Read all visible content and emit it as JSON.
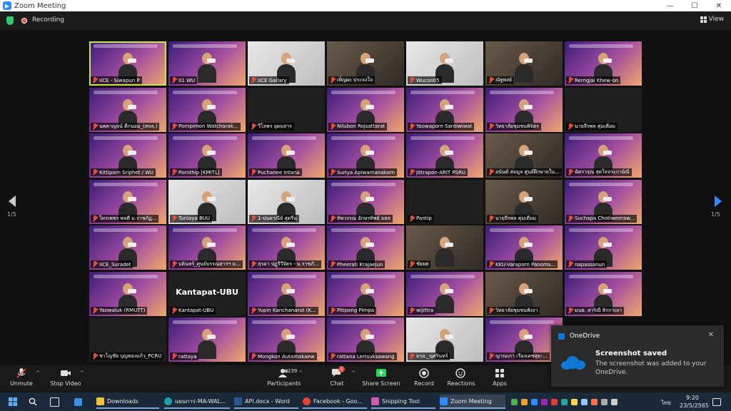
{
  "window": {
    "title": "Zoom Meeting",
    "min": "—",
    "max": "☐",
    "close": "✕"
  },
  "meeting": {
    "recording_label": "Recording",
    "view_label": "View"
  },
  "pager": {
    "page": "1/5"
  },
  "participants": [
    {
      "name": "IICE - Siwapun P",
      "style": "active"
    },
    {
      "name": "01 WU",
      "style": "slide"
    },
    {
      "name": "IICE Gallary",
      "style": "light"
    },
    {
      "name": "เพ็ญผะ ประจงใจ",
      "style": "photo"
    },
    {
      "name": "Wucon05",
      "style": "light"
    },
    {
      "name": "ณัฐพงษ์",
      "style": "photo"
    },
    {
      "name": "Rerngjai Khew-on",
      "style": "slide"
    },
    {
      "name": "นพคาญจน์ ดีกนอม_(สจล.)",
      "style": "slide"
    },
    {
      "name": "Pornpimon Watcharak...",
      "style": "slide"
    },
    {
      "name": "วีโลพร อุดมสาร",
      "style": "dark"
    },
    {
      "name": "Nilubon Rojsattarat",
      "style": "slide"
    },
    {
      "name": "Yaowaporn Santiwiwat",
      "style": "slide"
    },
    {
      "name": "วิทยาลัยชุมชนพิจิตร",
      "style": "slide"
    },
    {
      "name": "นายจีรพล คุ่มเตือม",
      "style": "dark"
    },
    {
      "name": "Kittiporn Sriphet / WU",
      "style": "slide"
    },
    {
      "name": "Pornthip [KMITL]",
      "style": "slide"
    },
    {
      "name": "Puchanee Intana",
      "style": "slide"
    },
    {
      "name": "Suriya Apiwantanakorn",
      "style": "slide"
    },
    {
      "name": "Jittrapon-ARIT PSRU",
      "style": "slide"
    },
    {
      "name": "อนันต์ สมมูล ศูนย์ฝึกษายใน...",
      "style": "photo"
    },
    {
      "name": "ฉัตรวรุณ สุดใจประกาย์ณี",
      "style": "slide"
    },
    {
      "name": "ใหรเพชร พลดี ม.ราชภัฏ...",
      "style": "slide"
    },
    {
      "name": "Tunlaya BUU",
      "style": "light"
    },
    {
      "name": "1-ปนดาณีย์ สุดรีน",
      "style": "light"
    },
    {
      "name": "ทิพวรรณ อักษรทิพย์ มธส",
      "style": "slide"
    },
    {
      "name": "Pantip",
      "style": "dark"
    },
    {
      "name": "นายจีรพล คุ่มเตือม",
      "style": "photo"
    },
    {
      "name": "Suchapa Chotiweeraw...",
      "style": "slide"
    },
    {
      "name": "IICE_Suradet",
      "style": "slide"
    },
    {
      "name": "บดินทร์_ศูนย์บรรณสารฯ ม...",
      "style": "slide"
    },
    {
      "name": "สุรดา ปฏุรีวีจิตร - ม.ราชภั...",
      "style": "slide"
    },
    {
      "name": "Pheerati Krajaejun",
      "style": "slide"
    },
    {
      "name": "ชัยยศ",
      "style": "photo"
    },
    {
      "name": "KKU-Varaporn Panoms...",
      "style": "slide"
    },
    {
      "name": "napassanun",
      "style": "slide"
    },
    {
      "name": "Yaowaluk (RMUTT)",
      "style": "slide"
    },
    {
      "name": "Kantapat-UBU",
      "style": "dark",
      "big": "Kantapat-UBU"
    },
    {
      "name": "Yupin Kanchanarut (K...",
      "style": "slide"
    },
    {
      "name": "Pitipong Pimpa",
      "style": "slide"
    },
    {
      "name": "wijittra",
      "style": "slide"
    },
    {
      "name": "วิทยาลัยชุมชนพังงา",
      "style": "photo"
    },
    {
      "name": "มนธ. สาริณี สิกกาเลา",
      "style": "slide"
    },
    {
      "name": "ชาโญชัย บุญทองแก้ว_PCRU",
      "style": "dark"
    },
    {
      "name": "rattaya",
      "style": "slide"
    },
    {
      "name": "Mongkon Autamakaew",
      "style": "slide"
    },
    {
      "name": "rattana Lertsuksawang",
      "style": "slide"
    },
    {
      "name": "มรอ._นุศรินทร์",
      "style": "light"
    },
    {
      "name": "ญาณเกา เรืองเดชสุม-...",
      "style": "slide"
    }
  ],
  "toolbar": {
    "unmute": "Unmute",
    "stop_video": "Stop Video",
    "participants": "Participants",
    "participant_count": "239",
    "chat": "Chat",
    "chat_badge": "1",
    "share_screen": "Share Screen",
    "record": "Record",
    "reactions": "Reactions",
    "apps": "Apps"
  },
  "toast": {
    "app": "OneDrive",
    "title": "Screenshot saved",
    "message": "The screenshot was added to your OneDrive."
  },
  "taskbar": {
    "downloads": "Downloads",
    "edge": "แผนการ-MA-WAL...",
    "word": "API.docx - Word",
    "chrome": "Facebook - Goo...",
    "snip": "Snipping Tool",
    "zoom": "Zoom Meeting",
    "lang": "ไทย",
    "time": "9:20",
    "date": "23/5/2565"
  },
  "colors": {
    "accent": "#2d8cff",
    "active_speaker": "#c8e64a",
    "share": "#23d959",
    "muted": "#e74c3c"
  }
}
